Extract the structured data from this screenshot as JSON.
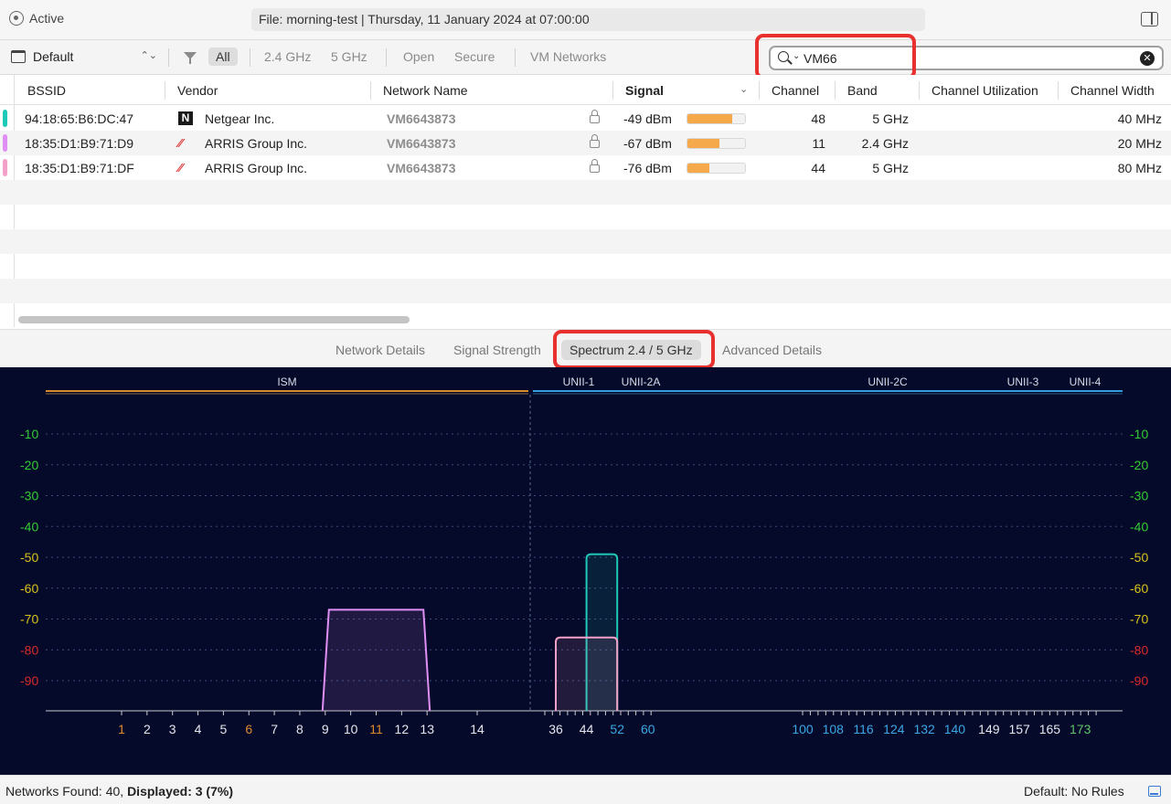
{
  "topbar": {
    "status": "Active",
    "file_title": "File: morning-test | Thursday, 11 January 2024 at 07:00:00"
  },
  "filterbar": {
    "profile": "Default",
    "filters": [
      "All",
      "2.4 GHz",
      "5 GHz",
      "Open",
      "Secure",
      "VM Networks"
    ],
    "active_filter": "All",
    "search_value": "VM66",
    "search_placeholder": ""
  },
  "table": {
    "columns": [
      "BSSID",
      "Vendor",
      "Network Name",
      "Signal",
      "Channel",
      "Band",
      "Channel Utilization",
      "Channel Width"
    ],
    "sorted_column": "Signal",
    "rows": [
      {
        "bssid": "94:18:65:B6:DC:47",
        "vendor": "Netgear Inc.",
        "vendor_icon": "netgear-logo",
        "network": "VM6643873",
        "signal": "-49 dBm",
        "signal_fraction": 0.78,
        "channel": "48",
        "band": "5 GHz",
        "utilization": "",
        "width": "40 MHz",
        "marker_color": "#1fc9b8"
      },
      {
        "bssid": "18:35:D1:B9:71:D9",
        "vendor": "ARRIS Group Inc.",
        "vendor_icon": "arris-logo",
        "network": "VM6643873",
        "signal": "-67 dBm",
        "signal_fraction": 0.55,
        "channel": "11",
        "band": "2.4 GHz",
        "utilization": "",
        "width": "20 MHz",
        "marker_color": "#e08ff5"
      },
      {
        "bssid": "18:35:D1:B9:71:DF",
        "vendor": "ARRIS Group Inc.",
        "vendor_icon": "arris-logo",
        "network": "VM6643873",
        "signal": "-76 dBm",
        "signal_fraction": 0.38,
        "channel": "44",
        "band": "5 GHz",
        "utilization": "",
        "width": "80 MHz",
        "marker_color": "#f5a0c8"
      }
    ]
  },
  "tabs": {
    "items": [
      "Network Details",
      "Signal Strength",
      "Spectrum 2.4 / 5 GHz",
      "Advanced Details"
    ],
    "active": "Spectrum 2.4 / 5 GHz"
  },
  "spectrum": {
    "bands": [
      "ISM",
      "UNII-1",
      "UNII-2A",
      "UNII-2C",
      "UNII-3",
      "UNII-4"
    ],
    "y_ticks": [
      "-10",
      "-20",
      "-30",
      "-40",
      "-50",
      "-60",
      "-70",
      "-80",
      "-90"
    ],
    "y_tick_values": [
      -10,
      -20,
      -30,
      -40,
      -50,
      -60,
      -70,
      -80,
      -90
    ],
    "channels_24": [
      "1",
      "2",
      "3",
      "4",
      "5",
      "6",
      "7",
      "8",
      "9",
      "10",
      "11",
      "12",
      "13",
      "14"
    ],
    "channels_5": [
      "36",
      "44",
      "52",
      "60",
      "100",
      "108",
      "116",
      "124",
      "132",
      "140",
      "149",
      "157",
      "165",
      "173"
    ],
    "networks": [
      {
        "name": "94:18:65:B6:DC:47",
        "band": "5 GHz",
        "channel": 48,
        "width_mhz": 40,
        "signal_dbm": -49,
        "color": "#1fc9b8"
      },
      {
        "name": "18:35:D1:B9:71:D9",
        "band": "2.4 GHz",
        "channel": 11,
        "width_mhz": 20,
        "signal_dbm": -67,
        "color": "#e08ff5"
      },
      {
        "name": "18:35:D1:B9:71:DF",
        "band": "5 GHz",
        "channel": 44,
        "width_mhz": 80,
        "signal_dbm": -76,
        "color": "#f5a0c8"
      }
    ],
    "colors": {
      "ism": "#d98a2b",
      "unii": "#2f9fe0",
      "grid": "#3a4a7a",
      "tick_green": "#33cc33",
      "tick_yellow": "#d6c21a",
      "tick_red": "#d92a2a",
      "ch_orange": "#e08a2c",
      "ch_blue": "#3aa7e6",
      "ch_green": "#5fc46a"
    }
  },
  "statusbar": {
    "networks_found_label": "Networks Found: 40,",
    "displayed_label": "Displayed: 3 (7%)",
    "rules": "Default: No Rules"
  }
}
